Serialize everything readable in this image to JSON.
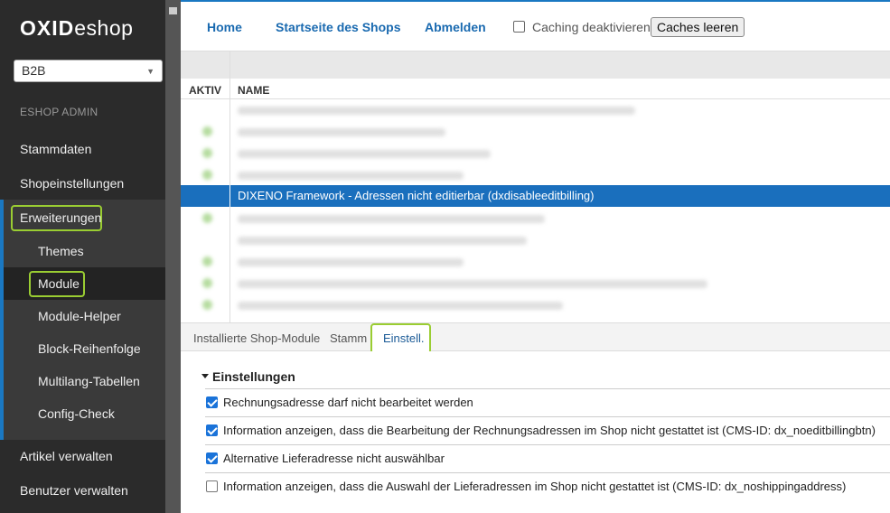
{
  "sidebar": {
    "logo_bold": "OXID",
    "logo_text": "eshop",
    "shop_select_value": "B2B",
    "section_label": "ESHOP ADMIN",
    "nav": [
      {
        "label": "Stammdaten"
      },
      {
        "label": "Shopeinstellungen"
      },
      {
        "label": "Erweiterungen"
      },
      {
        "label": "Artikel verwalten"
      },
      {
        "label": "Benutzer verwalten"
      }
    ],
    "sub_nav": [
      {
        "label": "Themes"
      },
      {
        "label": "Module"
      },
      {
        "label": "Module-Helper"
      },
      {
        "label": "Block-Reihenfolge"
      },
      {
        "label": "Multilang-Tabellen"
      },
      {
        "label": "Config-Check"
      }
    ]
  },
  "topbar": {
    "home": "Home",
    "shop_start": "Startseite des Shops",
    "logout": "Abmelden",
    "caching_label": "Caching deaktivieren",
    "clear_caches": "Caches leeren"
  },
  "module_list": {
    "col_active": "AKTIV",
    "col_name": "NAME",
    "selected_row_name": "DIXENO Framework - Adressen nicht editierbar (dxdisableeditbilling)"
  },
  "tabs": {
    "items": [
      {
        "label": "Installierte Shop-Module"
      },
      {
        "label": "Stamm"
      },
      {
        "label": "Einstell."
      }
    ],
    "active": "Einstell."
  },
  "settings": {
    "group_title": "Einstellungen",
    "options": [
      {
        "label": "Rechnungsadresse darf nicht bearbeitet werden",
        "checked": true
      },
      {
        "label": "Information anzeigen, dass die Bearbeitung der Rechnungsadressen im Shop nicht gestattet ist (CMS-ID: dx_noeditbillingbtn)",
        "checked": true
      },
      {
        "label": "Alternative Lieferadresse nicht auswählbar",
        "checked": true
      },
      {
        "label": "Information anzeigen, dass die Auswahl der Lieferadressen im Shop nicht gestattet ist (CMS-ID: dx_noshippingaddress)",
        "checked": false
      }
    ]
  },
  "colors": {
    "accent": "#1a78c2",
    "highlight_outline": "#9acd32",
    "selected_row": "#1a6fbd"
  }
}
